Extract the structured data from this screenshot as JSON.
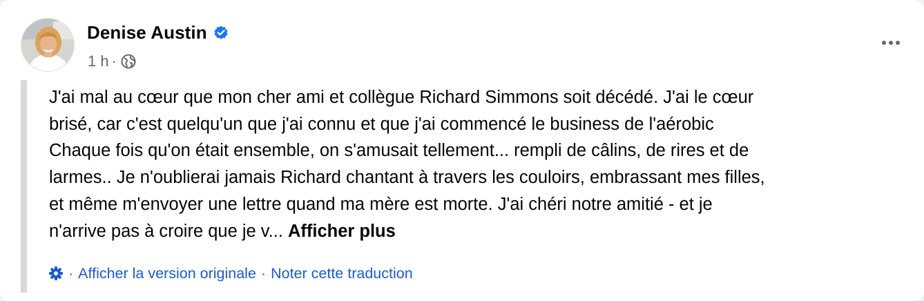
{
  "post": {
    "author_name": "Denise Austin",
    "verified": true,
    "time": "1 h",
    "meta_separator": "·",
    "audience_icon": "globe-icon",
    "more_options_icon": "ellipsis-icon",
    "text_lines": [
      "J'ai mal au cœur que mon cher ami et collègue Richard Simmons soit décédé. J'ai le cœur",
      "brisé, car c'est quelqu'un que j'ai connu et que j'ai commencé le business de l'aérobic",
      "Chaque fois qu'on était ensemble, on s'amusait tellement... rempli de câlins, de rires et de",
      "larmes.. Je n'oublierai jamais Richard chantant à travers les couloirs, embrassant mes filles,",
      "et même m'envoyer une lettre quand ma mère est morte. J'ai chéri notre amitié - et je",
      "n'arrive pas à croire que je v... "
    ],
    "see_more_label": "Afficher plus"
  },
  "translation": {
    "icon": "gear-icon",
    "separator": "·",
    "show_original_label": "Afficher la version originale",
    "rate_translation_label": "Noter cette traduction"
  },
  "colors": {
    "verified_blue": "#1877f2",
    "link_blue": "#1a5ccc",
    "secondary_text": "#65676b",
    "quote_bar": "#d9d9d9"
  }
}
